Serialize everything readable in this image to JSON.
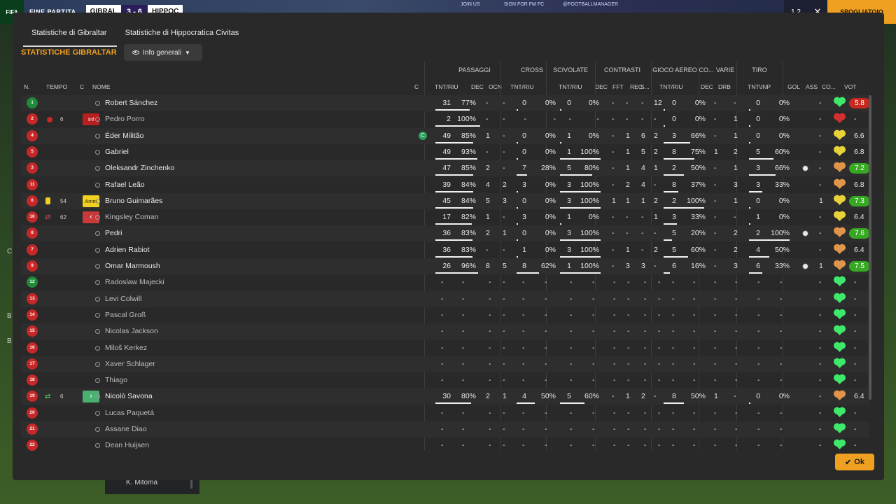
{
  "topbar": {
    "logo": "FIFA",
    "label": "FINE PARTITA",
    "team_home": "GIBRAL",
    "score": "3 - 6",
    "team_away": "HIPPOC",
    "sponsor1": "JOIN US",
    "sponsor2": "SIGN FOR FM FC",
    "sponsor3": "@FOOTBALLMANAGER",
    "counter": "1 2",
    "close_symbol": "✕",
    "action_label": "SPOGLIATOIO"
  },
  "side": {
    "c": "C",
    "b1": "B",
    "b2": "B"
  },
  "bottom_panel": {
    "name": "K. Mitoma"
  },
  "dialog": {
    "tabs": [
      "Statistiche di Gibraltar",
      "Statistiche di Hippocratica Civitas"
    ],
    "active_tab": 0,
    "section_title": "STATISTICHE GIBRALTAR",
    "view_dropdown": "Info generali",
    "ok_label": "Ok"
  },
  "headers": {
    "groups": [
      "PASSAGGI",
      "CROSS",
      "SCIVOLATE",
      "CONTRASTI",
      "GIOCO AEREO",
      "CO...",
      "VARIE",
      "TIRO"
    ],
    "cols": [
      "N.",
      "TEMPO",
      "C",
      "NOME",
      "C",
      "TNT/RIU",
      "DEC",
      "OCN",
      "TNT/RIU",
      "TNT/RIU",
      "DEC",
      "FFT",
      "REC",
      "S...",
      "TNT/RIU",
      "DEC",
      "DRB",
      "TNT\\INP",
      "GOL",
      "ASS",
      "CO...",
      "VOT"
    ]
  },
  "colors": {
    "accent": "#f0a020",
    "rating_green": "#36a822",
    "rating_red": "#c8291f"
  },
  "players": [
    {
      "n": "1",
      "shirt": "green",
      "time": "",
      "c": "",
      "name": "Robert Sánchez",
      "sub": false,
      "cap": "",
      "p": [
        "31",
        "77%"
      ],
      "pbar": 0.77,
      "pdec": "-",
      "pocn": "-",
      "cr": [
        "0",
        "0%"
      ],
      "crbar": 0,
      "sc": [
        "0",
        "0%"
      ],
      "scbar": 0,
      "cdec": "-",
      "cfft": "-",
      "crec": "-",
      "cs": "12",
      "ga": [
        "0",
        "0%"
      ],
      "gabar": 0,
      "co": "-",
      "drb": "-",
      "ti": [
        "0",
        "0%"
      ],
      "tibar": 0,
      "gol": "",
      "ass": "-",
      "cond": "green",
      "vot": "5.8",
      "vstyle": "red"
    },
    {
      "n": "2",
      "shirt": "red",
      "time": "6",
      "c": "Inf",
      "icon": "injury",
      "name": "Pedro Porro",
      "sub": true,
      "cap": "",
      "p": [
        "2",
        "100%"
      ],
      "pbar": 1,
      "pdec": "-",
      "pocn": "-",
      "cr": [
        "-",
        "-"
      ],
      "crbar": -1,
      "sc": [
        "-",
        "-"
      ],
      "scbar": -1,
      "cdec": "-",
      "cfft": "-",
      "crec": "-",
      "cs": "-",
      "ga": [
        "0",
        "0%"
      ],
      "gabar": 0,
      "co": "-",
      "drb": "1",
      "ti": [
        "0",
        "0%"
      ],
      "tibar": 0,
      "gol": "",
      "ass": "-",
      "cond": "red",
      "vot": "-",
      "vstyle": ""
    },
    {
      "n": "4",
      "shirt": "red",
      "time": "",
      "c": "",
      "name": "Éder Militão",
      "sub": false,
      "cap": "C",
      "p": [
        "49",
        "85%"
      ],
      "pbar": 0.85,
      "pdec": "1",
      "pocn": "-",
      "cr": [
        "0",
        "0%"
      ],
      "crbar": 0,
      "sc": [
        "1",
        "0%"
      ],
      "scbar": 0,
      "cdec": "-",
      "cfft": "1",
      "crec": "6",
      "cs": "2",
      "ga": [
        "3",
        "66%"
      ],
      "gabar": 0.66,
      "co": "-",
      "drb": "1",
      "ti": [
        "0",
        "0%"
      ],
      "tibar": 0,
      "gol": "",
      "ass": "-",
      "cond": "yellow",
      "vot": "6.6",
      "vstyle": ""
    },
    {
      "n": "5",
      "shirt": "red",
      "time": "",
      "c": "",
      "name": "Gabriel",
      "sub": false,
      "cap": "",
      "p": [
        "49",
        "93%"
      ],
      "pbar": 0.93,
      "pdec": "-",
      "pocn": "-",
      "cr": [
        "0",
        "0%"
      ],
      "crbar": 0,
      "sc": [
        "1",
        "100%"
      ],
      "scbar": 1,
      "cdec": "-",
      "cfft": "1",
      "crec": "5",
      "cs": "2",
      "ga": [
        "8",
        "75%"
      ],
      "gabar": 0.75,
      "co": "1",
      "drb": "2",
      "ti": [
        "5",
        "60%"
      ],
      "tibar": 0.6,
      "gol": "",
      "ass": "-",
      "cond": "yellow",
      "vot": "6.8",
      "vstyle": ""
    },
    {
      "n": "3",
      "shirt": "red",
      "time": "",
      "c": "",
      "name": "Oleksandr Zinchenko",
      "sub": false,
      "cap": "",
      "p": [
        "47",
        "85%"
      ],
      "pbar": 0.85,
      "pdec": "2",
      "pocn": "-",
      "cr": [
        "7",
        "28%"
      ],
      "crbar": 0.28,
      "sc": [
        "5",
        "80%"
      ],
      "scbar": 0.8,
      "cdec": "-",
      "cfft": "1",
      "crec": "4",
      "cs": "1",
      "ga": [
        "2",
        "50%"
      ],
      "gabar": 0.5,
      "co": "-",
      "drb": "1",
      "ti": [
        "3",
        "66%"
      ],
      "tibar": 0.66,
      "gol": "ball",
      "ass": "-",
      "cond": "orange",
      "vot": "7.2",
      "vstyle": "green"
    },
    {
      "n": "11",
      "shirt": "red",
      "time": "",
      "c": "",
      "name": "Rafael Leão",
      "sub": false,
      "cap": "",
      "p": [
        "39",
        "84%"
      ],
      "pbar": 0.84,
      "pdec": "4",
      "pocn": "2",
      "cr": [
        "3",
        "0%"
      ],
      "crbar": 0,
      "sc": [
        "3",
        "100%"
      ],
      "scbar": 1,
      "cdec": "-",
      "cfft": "2",
      "crec": "4",
      "cs": "-",
      "ga": [
        "8",
        "37%"
      ],
      "gabar": 0.37,
      "co": "-",
      "drb": "3",
      "ti": [
        "3",
        "33%"
      ],
      "tibar": 0.33,
      "gol": "",
      "ass": "-",
      "cond": "orange",
      "vot": "6.8",
      "vstyle": ""
    },
    {
      "n": "6",
      "shirt": "red",
      "time": "54",
      "c": "Amm",
      "icon": "yellow",
      "name": "Bruno Guimarães",
      "sub": false,
      "cap": "",
      "p": [
        "45",
        "84%"
      ],
      "pbar": 0.84,
      "pdec": "5",
      "pocn": "3",
      "cr": [
        "0",
        "0%"
      ],
      "crbar": 0,
      "sc": [
        "3",
        "100%"
      ],
      "scbar": 1,
      "cdec": "1",
      "cfft": "1",
      "crec": "1",
      "cs": "2",
      "ga": [
        "2",
        "100%"
      ],
      "gabar": 1,
      "co": "-",
      "drb": "1",
      "ti": [
        "0",
        "0%"
      ],
      "tibar": 0,
      "gol": "",
      "ass": "1",
      "cond": "yellow",
      "vot": "7.3",
      "vstyle": "green"
    },
    {
      "n": "10",
      "shirt": "red",
      "time": "62",
      "c": "out",
      "icon": "subout",
      "name": "Kingsley Coman",
      "sub": true,
      "cap": "",
      "p": [
        "17",
        "82%"
      ],
      "pbar": 0.82,
      "pdec": "1",
      "pocn": "-",
      "cr": [
        "3",
        "0%"
      ],
      "crbar": 0,
      "sc": [
        "1",
        "0%"
      ],
      "scbar": 0,
      "cdec": "-",
      "cfft": "-",
      "crec": "-",
      "cs": "1",
      "ga": [
        "3",
        "33%"
      ],
      "gabar": 0.33,
      "co": "-",
      "drb": "-",
      "ti": [
        "1",
        "0%"
      ],
      "tibar": 0,
      "gol": "",
      "ass": "-",
      "cond": "yellow",
      "vot": "6.4",
      "vstyle": ""
    },
    {
      "n": "8",
      "shirt": "red",
      "time": "",
      "c": "",
      "name": "Pedri",
      "sub": false,
      "cap": "",
      "p": [
        "36",
        "83%"
      ],
      "pbar": 0.83,
      "pdec": "2",
      "pocn": "1",
      "cr": [
        "0",
        "0%"
      ],
      "crbar": 0,
      "sc": [
        "3",
        "100%"
      ],
      "scbar": 1,
      "cdec": "-",
      "cfft": "-",
      "crec": "-",
      "cs": "-",
      "ga": [
        "5",
        "20%"
      ],
      "gabar": 0.2,
      "co": "-",
      "drb": "2",
      "ti": [
        "2",
        "100%"
      ],
      "tibar": 1,
      "gol": "ball",
      "ass": "-",
      "cond": "orange",
      "vot": "7.6",
      "vstyle": "green"
    },
    {
      "n": "7",
      "shirt": "red",
      "time": "",
      "c": "",
      "name": "Adrien Rabiot",
      "sub": false,
      "cap": "",
      "p": [
        "36",
        "83%"
      ],
      "pbar": 0.83,
      "pdec": "-",
      "pocn": "-",
      "cr": [
        "1",
        "0%"
      ],
      "crbar": 0,
      "sc": [
        "3",
        "100%"
      ],
      "scbar": 1,
      "cdec": "-",
      "cfft": "1",
      "crec": "-",
      "cs": "2",
      "ga": [
        "5",
        "60%"
      ],
      "gabar": 0.6,
      "co": "-",
      "drb": "2",
      "ti": [
        "4",
        "50%"
      ],
      "tibar": 0.5,
      "gol": "",
      "ass": "-",
      "cond": "orange",
      "vot": "6.4",
      "vstyle": ""
    },
    {
      "n": "9",
      "shirt": "red",
      "time": "",
      "c": "",
      "name": "Omar Marmoush",
      "sub": false,
      "cap": "",
      "p": [
        "26",
        "96%"
      ],
      "pbar": 0.96,
      "pdec": "8",
      "pocn": "5",
      "cr": [
        "8",
        "62%"
      ],
      "crbar": 0.62,
      "sc": [
        "1",
        "100%"
      ],
      "scbar": 1,
      "cdec": "-",
      "cfft": "3",
      "crec": "3",
      "cs": "-",
      "ga": [
        "6",
        "16%"
      ],
      "gabar": 0.16,
      "co": "-",
      "drb": "3",
      "ti": [
        "6",
        "33%"
      ],
      "tibar": 0.33,
      "gol": "ball",
      "ass": "1",
      "cond": "orange",
      "vot": "7.5",
      "vstyle": "green"
    },
    {
      "n": "12",
      "shirt": "green",
      "time": "",
      "c": "",
      "name": "Radoslaw Majecki",
      "sub": true,
      "empty": true,
      "cond": "green",
      "vot": "-"
    },
    {
      "n": "13",
      "shirt": "red",
      "time": "",
      "c": "",
      "name": "Levi Colwill",
      "sub": true,
      "empty": true,
      "cond": "green",
      "vot": "-"
    },
    {
      "n": "14",
      "shirt": "red",
      "time": "",
      "c": "",
      "name": "Pascal Groß",
      "sub": true,
      "empty": true,
      "cond": "green",
      "vot": "-"
    },
    {
      "n": "15",
      "shirt": "red",
      "time": "",
      "c": "",
      "name": "Nicolas Jackson",
      "sub": true,
      "empty": true,
      "cond": "green",
      "vot": "-"
    },
    {
      "n": "16",
      "shirt": "red",
      "time": "",
      "c": "",
      "name": "Miloš Kerkez",
      "sub": true,
      "empty": true,
      "cond": "green",
      "vot": "-"
    },
    {
      "n": "17",
      "shirt": "red",
      "time": "",
      "c": "",
      "name": "Xaver Schlager",
      "sub": true,
      "empty": true,
      "cond": "green",
      "vot": "-"
    },
    {
      "n": "18",
      "shirt": "red",
      "time": "",
      "c": "",
      "name": "Thiago",
      "sub": true,
      "empty": true,
      "cond": "green",
      "vot": "-"
    },
    {
      "n": "19",
      "shirt": "red",
      "time": "6",
      "c": "in",
      "icon": "subin",
      "name": "Nicolò Savona",
      "sub": false,
      "cap": "",
      "p": [
        "30",
        "80%"
      ],
      "pbar": 0.8,
      "pdec": "2",
      "pocn": "1",
      "cr": [
        "4",
        "50%"
      ],
      "crbar": 0.5,
      "sc": [
        "5",
        "60%"
      ],
      "scbar": 0.6,
      "cdec": "-",
      "cfft": "1",
      "crec": "2",
      "cs": "-",
      "ga": [
        "8",
        "50%"
      ],
      "gabar": 0.5,
      "co": "1",
      "drb": "-",
      "ti": [
        "0",
        "0%"
      ],
      "tibar": 0,
      "gol": "",
      "ass": "-",
      "cond": "orange",
      "vot": "6.4",
      "vstyle": ""
    },
    {
      "n": "20",
      "shirt": "red",
      "time": "",
      "c": "",
      "name": "Lucas Paquetá",
      "sub": true,
      "empty": true,
      "cond": "green",
      "vot": "-"
    },
    {
      "n": "21",
      "shirt": "red",
      "time": "",
      "c": "",
      "name": "Assane Diao",
      "sub": true,
      "empty": true,
      "cond": "green",
      "vot": "-"
    },
    {
      "n": "22",
      "shirt": "red",
      "time": "",
      "c": "",
      "name": "Dean Huijsen",
      "sub": true,
      "empty": true,
      "cond": "green",
      "vot": "-"
    }
  ]
}
